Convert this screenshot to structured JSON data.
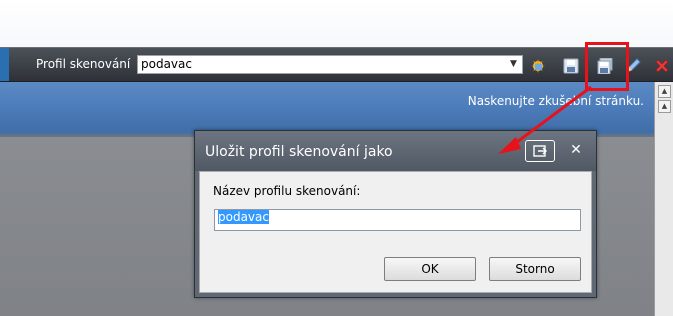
{
  "toolbar": {
    "profile_label": "Profil skenování",
    "profile_value": "podavac",
    "icons": [
      "dropdown-arrow-icon",
      "scan-icon",
      "save-icon",
      "save-as-icon",
      "edit-icon",
      "delete-icon"
    ]
  },
  "main": {
    "hint": "Naskenujte zkušební stránku."
  },
  "dialog": {
    "title": "Uložit profil skenování jako",
    "field_label": "Název profilu skenování:",
    "input_value": "podavac",
    "ok_label": "OK",
    "cancel_label": "Storno"
  },
  "colors": {
    "annotation": "#e8121b",
    "toolbar": "#3a3f46",
    "selection": "#3399ff"
  }
}
